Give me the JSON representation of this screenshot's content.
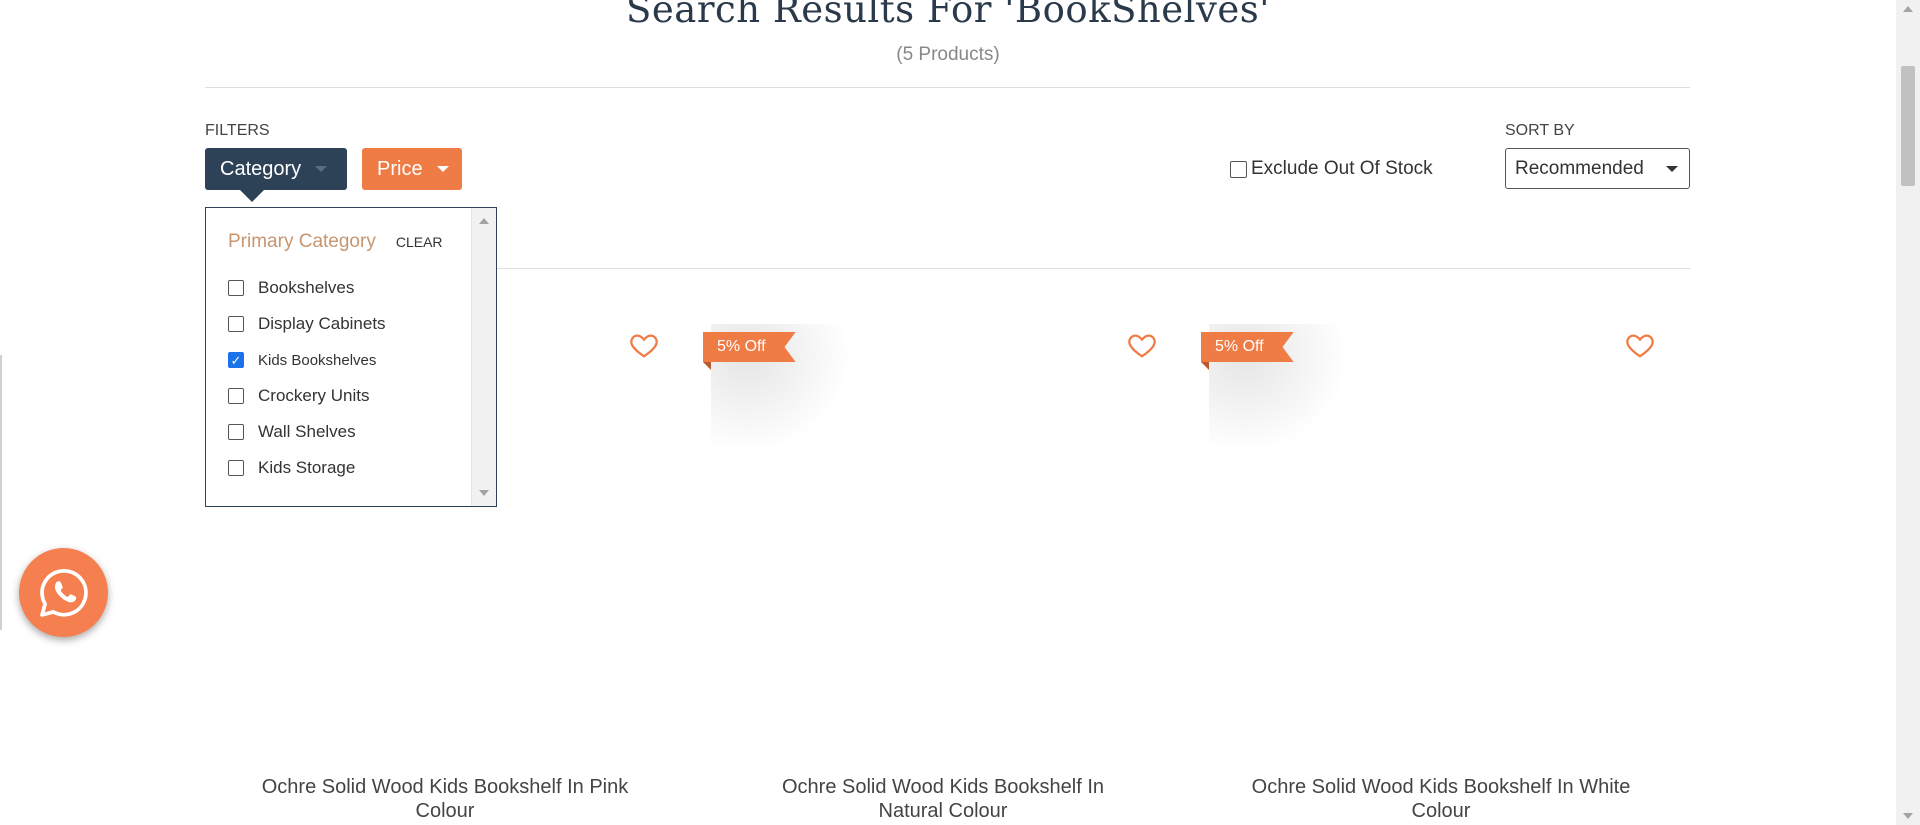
{
  "header": {
    "title": "Search Results For 'BookShelves'",
    "count": "(5 Products)"
  },
  "filters": {
    "label": "FILTERS",
    "category_btn": "Category",
    "price_btn": "Price",
    "dropdown": {
      "title": "Primary Category",
      "clear": "CLEAR",
      "options": [
        {
          "label": "Bookshelves",
          "checked": false
        },
        {
          "label": "Display Cabinets",
          "checked": false
        },
        {
          "label": "Kids Bookshelves",
          "checked": true
        },
        {
          "label": "Crockery Units",
          "checked": false
        },
        {
          "label": "Wall Shelves",
          "checked": false
        },
        {
          "label": "Kids Storage",
          "checked": false
        }
      ]
    }
  },
  "exclude_label": "Exclude Out Of Stock",
  "sort": {
    "label": "SORT BY",
    "value": "Recommended"
  },
  "products": [
    {
      "name_line1": "Ochre Solid Wood Kids Bookshelf In Pink",
      "name_line2": "Colour",
      "badge": ""
    },
    {
      "name_line1": "Ochre Solid Wood Kids Bookshelf In",
      "name_line2": "Natural Colour",
      "badge": "5% Off"
    },
    {
      "name_line1": "Ochre Solid Wood Kids Bookshelf In White",
      "name_line2": "Colour",
      "badge": "5% Off"
    }
  ],
  "colors": {
    "navy": "#2d4256",
    "orange": "#ef7b45",
    "accent_text": "#c79570"
  },
  "icons": {
    "wishlist": "heart-icon",
    "chat": "whatsapp-icon"
  }
}
